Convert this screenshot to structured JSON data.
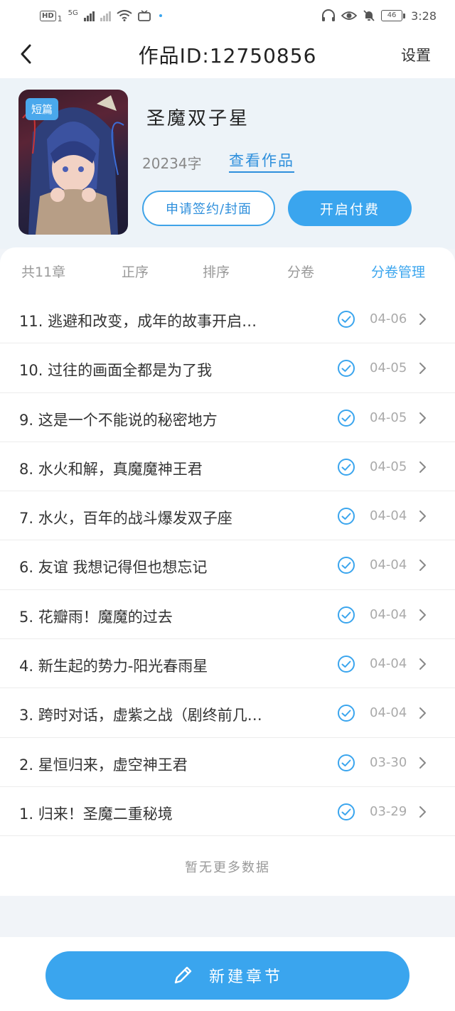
{
  "status_bar": {
    "hd_badge": "HD",
    "sim": "1",
    "network": "5G",
    "battery": "46",
    "time": "3:28"
  },
  "nav": {
    "title": "作品ID:12750856",
    "settings_label": "设置"
  },
  "work": {
    "cover_badge": "短篇",
    "title": "圣魔双子星",
    "word_count": "20234字",
    "view_link": "查看作品",
    "apply_button": "申请签约/封面",
    "pay_button": "开启付费"
  },
  "tabs": {
    "total": "共11章",
    "order_asc": "正序",
    "sort": "排序",
    "volume": "分卷",
    "volume_manage": "分卷管理"
  },
  "chapters": [
    {
      "title": "11. 逃避和改变，成年的故事开启…",
      "date": "04-06"
    },
    {
      "title": "10. 过往的画面全都是为了我",
      "date": "04-05"
    },
    {
      "title": "9. 这是一个不能说的秘密地方",
      "date": "04-05"
    },
    {
      "title": "8. 水火和解，真魔魔神王君",
      "date": "04-05"
    },
    {
      "title": "7. 水火，百年的战斗爆发双子座",
      "date": "04-04"
    },
    {
      "title": "6. 友谊 我想记得但也想忘记",
      "date": "04-04"
    },
    {
      "title": "5. 花瓣雨！魔魔的过去",
      "date": "04-04"
    },
    {
      "title": "4. 新生起的势力-阳光春雨星",
      "date": "04-04"
    },
    {
      "title": "3. 跨时对话，虚紫之战（剧终前几…",
      "date": "04-04"
    },
    {
      "title": "2. 星恒归来，虚空神王君",
      "date": "03-30"
    },
    {
      "title": "1. 归来！圣魔二重秘境",
      "date": "03-29"
    }
  ],
  "no_more_text": "暂无更多数据",
  "bottom": {
    "new_chapter": "新建章节"
  },
  "colors": {
    "accent": "#3aa5ee",
    "link": "#2e8fdc",
    "background": "#f1f4f8"
  }
}
